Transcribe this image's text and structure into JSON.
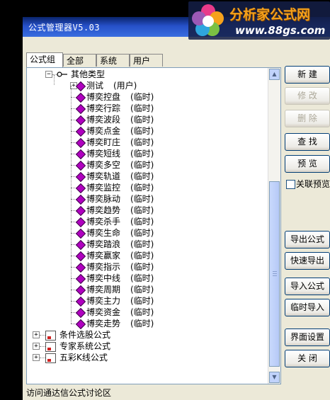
{
  "window": {
    "title": "公式管理器V5.03"
  },
  "logo": {
    "brand": "分析家公式网",
    "url": "www.88gs.com"
  },
  "tabs": [
    {
      "label": "公式组"
    },
    {
      "label": "全部"
    },
    {
      "label": "系统"
    },
    {
      "label": "用户"
    }
  ],
  "tree": {
    "root_label": "其他类型",
    "user_item": {
      "label": "测试",
      "tag": "(用户)"
    },
    "temp_tag": "(临时)",
    "items": [
      "博奕控盘",
      "博奕行踪",
      "博奕波段",
      "博奕点金",
      "博奕盯庄",
      "博奕短线",
      "博奕多空",
      "博奕轨道",
      "博奕监控",
      "博奕脉动",
      "博奕趋势",
      "博奕杀手",
      "博奕生命",
      "博奕踏浪",
      "博奕赢家",
      "博奕指示",
      "博奕中线",
      "博奕周期",
      "博奕主力",
      "博奕资金",
      "博奕走势"
    ],
    "groups": [
      "条件选股公式",
      "专家系统公式",
      "五彩K线公式"
    ]
  },
  "buttons": {
    "new": "新 建",
    "modify": "修 改",
    "delete": "删 除",
    "find": "查 找",
    "preview": "预 览",
    "linked_preview": "关联预览",
    "export": "导出公式",
    "quick_export": "快速导出",
    "import": "导入公式",
    "temp_import": "临时导入",
    "ui_settings": "界面设置",
    "close": "关 闭"
  },
  "status_text": "访问通达信公式讨论区"
}
